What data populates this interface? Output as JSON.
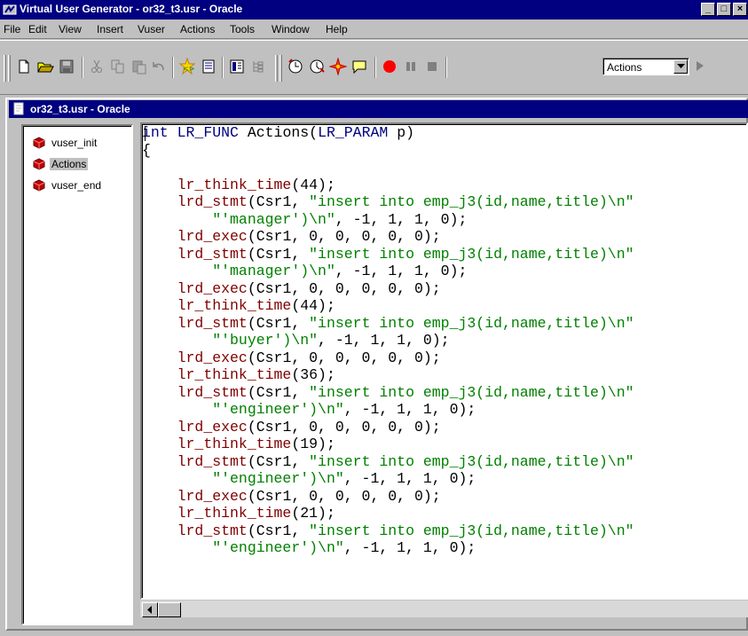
{
  "window": {
    "title": "Virtual User Generator - or32_t3.usr - Oracle",
    "controls": {
      "minimize": "_",
      "restore": "□",
      "close": "×"
    }
  },
  "menu": [
    "File",
    "Edit",
    "View",
    "Insert",
    "Vuser",
    "Actions",
    "Tools",
    "Window",
    "Help"
  ],
  "toolbar": {
    "actions_dropdown": "Actions",
    "buttons": [
      "new",
      "open",
      "save",
      "cut",
      "copy",
      "paste",
      "undo",
      "compile",
      "script-view",
      "tree-view",
      "show-tree",
      "record",
      "run-step",
      "breakpoint",
      "comment",
      "start-recording",
      "pause",
      "stop",
      "browser"
    ]
  },
  "document": {
    "title": "or32_t3.usr - Oracle"
  },
  "tree": {
    "items": [
      {
        "label": "vuser_init",
        "selected": false
      },
      {
        "label": "Actions",
        "selected": true
      },
      {
        "label": "vuser_end",
        "selected": false
      }
    ]
  },
  "code": {
    "lines": [
      "int LR_FUNC Actions(LR_PARAM p)",
      "{",
      "",
      "    lr_think_time(44);",
      "    lrd_stmt(Csr1, \"insert into emp_j3(id,name,title)\\n\"",
      "        \"'manager')\\n\", -1, 1, 1, 0);",
      "    lrd_exec(Csr1, 0, 0, 0, 0, 0);",
      "    lrd_stmt(Csr1, \"insert into emp_j3(id,name,title)\\n\"",
      "        \"'manager')\\n\", -1, 1, 1, 0);",
      "    lrd_exec(Csr1, 0, 0, 0, 0, 0);",
      "    lr_think_time(44);",
      "    lrd_stmt(Csr1, \"insert into emp_j3(id,name,title)\\n\"",
      "        \"'buyer')\\n\", -1, 1, 1, 0);",
      "    lrd_exec(Csr1, 0, 0, 0, 0, 0);",
      "    lr_think_time(36);",
      "    lrd_stmt(Csr1, \"insert into emp_j3(id,name,title)\\n\"",
      "        \"'engineer')\\n\", -1, 1, 1, 0);",
      "    lrd_exec(Csr1, 0, 0, 0, 0, 0);",
      "    lr_think_time(19);",
      "    lrd_stmt(Csr1, \"insert into emp_j3(id,name,title)\\n\"",
      "        \"'engineer')\\n\", -1, 1, 1, 0);",
      "    lrd_exec(Csr1, 0, 0, 0, 0, 0);",
      "    lr_think_time(21);",
      "    lrd_stmt(Csr1, \"insert into emp_j3(id,name,title)\\n\"",
      "        \"'engineer')\\n\", -1, 1, 1, 0);"
    ]
  },
  "colors": {
    "titlebar": "#000080",
    "keyword": "#000080",
    "function": "#800000",
    "string": "#008000",
    "face": "#c0c0c0"
  }
}
